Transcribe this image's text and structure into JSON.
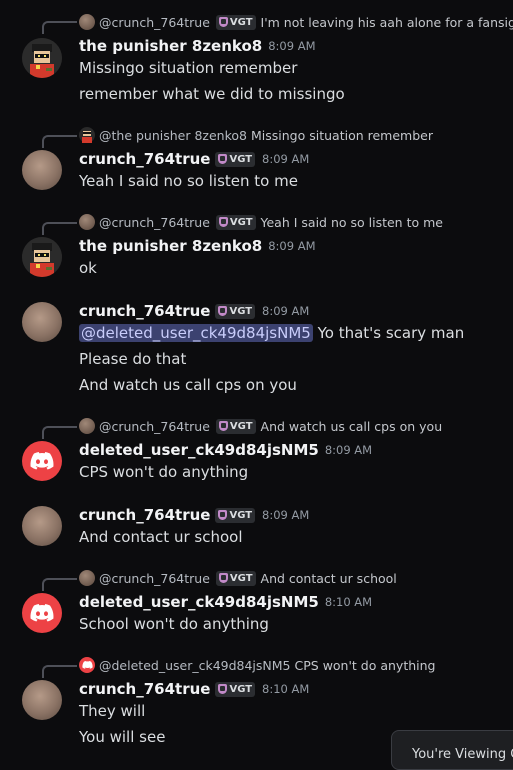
{
  "messages": [
    {
      "reply": {
        "name": "@crunch_764true",
        "tag": "VGT",
        "text": "I'm not leaving his aah alone for a fansign"
      },
      "user": "the punisher 8zenko8",
      "tag": "",
      "time": "8:09 AM",
      "lines": [
        "Missingo situation remember",
        "remember what we did to missingo"
      ]
    },
    {
      "reply": {
        "name": "@the punisher 8zenko8",
        "tag": "",
        "text": "Missingo situation remember"
      },
      "user": "crunch_764true",
      "tag": "VGT",
      "time": "8:09 AM",
      "lines": [
        "Yeah I said no so listen to me"
      ]
    },
    {
      "reply": {
        "name": "@crunch_764true",
        "tag": "VGT",
        "text": "Yeah I said no so listen to me"
      },
      "user": "the punisher 8zenko8",
      "tag": "",
      "time": "8:09 AM",
      "lines": [
        "ok"
      ]
    },
    {
      "user": "crunch_764true",
      "tag": "VGT",
      "time": "8:09 AM",
      "mention": "@deleted_user_ck49d84jsNM5",
      "lines": [
        " Yo that's scary man",
        "Please do that",
        "And watch us call cps on you"
      ]
    },
    {
      "reply": {
        "name": "@crunch_764true",
        "tag": "VGT",
        "text": "And watch us call cps on you"
      },
      "user": "deleted_user_ck49d84jsNM5",
      "tag": "",
      "time": "8:09 AM",
      "lines": [
        "CPS won't do anything"
      ]
    },
    {
      "user": "crunch_764true",
      "tag": "VGT",
      "time": "8:09 AM",
      "lines": [
        "And contact ur school"
      ]
    },
    {
      "reply": {
        "name": "@crunch_764true",
        "tag": "VGT",
        "text": "And contact ur school"
      },
      "user": "deleted_user_ck49d84jsNM5",
      "tag": "",
      "time": "8:10 AM",
      "lines": [
        "School won't do anything"
      ]
    },
    {
      "reply": {
        "name": "@deleted_user_ck49d84jsNM5",
        "tag": "",
        "text": "CPS won't do anything"
      },
      "user": "crunch_764true",
      "tag": "VGT",
      "time": "8:10 AM",
      "lines": [
        "They will",
        "You will see"
      ]
    }
  ],
  "toast": {
    "text": "You're Viewing O"
  },
  "colors": {
    "background": "#0c0c0e",
    "mention_bg": "#3c4270",
    "discord_red": "#ed4245",
    "role_tag": "#c28ac8"
  }
}
